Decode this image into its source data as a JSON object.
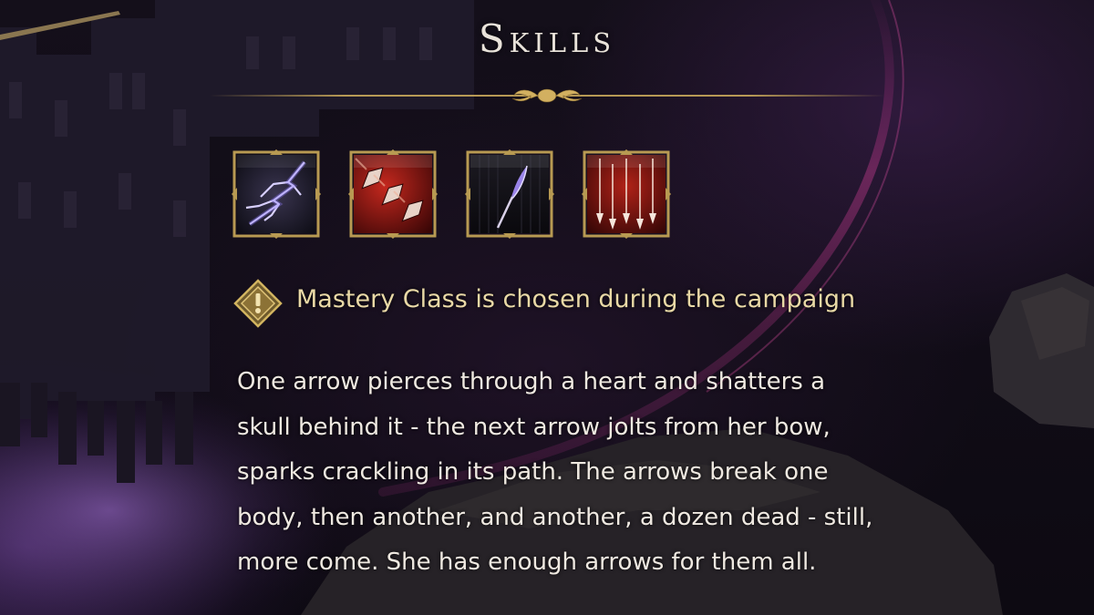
{
  "title": "Skills",
  "notice": {
    "icon": "exclamation-diamond-icon",
    "text": "Mastery Class is chosen during the campaign",
    "color": "#e9d9a6"
  },
  "skills": [
    {
      "icon": "lightning-bolt-icon"
    },
    {
      "icon": "triple-arrowheads-icon"
    },
    {
      "icon": "feather-arrow-icon"
    },
    {
      "icon": "arrow-rain-icon"
    }
  ],
  "description": {
    "lines": [
      "One arrow pierces through a heart and shatters a",
      "skull behind it - the next arrow jolts from her bow,",
      "sparks crackling in its path. The arrows break one",
      "body, then another, and another, a dozen dead - still,",
      "more come. She has enough arrows for them all."
    ]
  },
  "colors": {
    "gold": "#c8a85a",
    "title": "#e9e3da",
    "text": "#efe9e1",
    "bolt": "#b9a8ff",
    "red": "#c4281e"
  }
}
